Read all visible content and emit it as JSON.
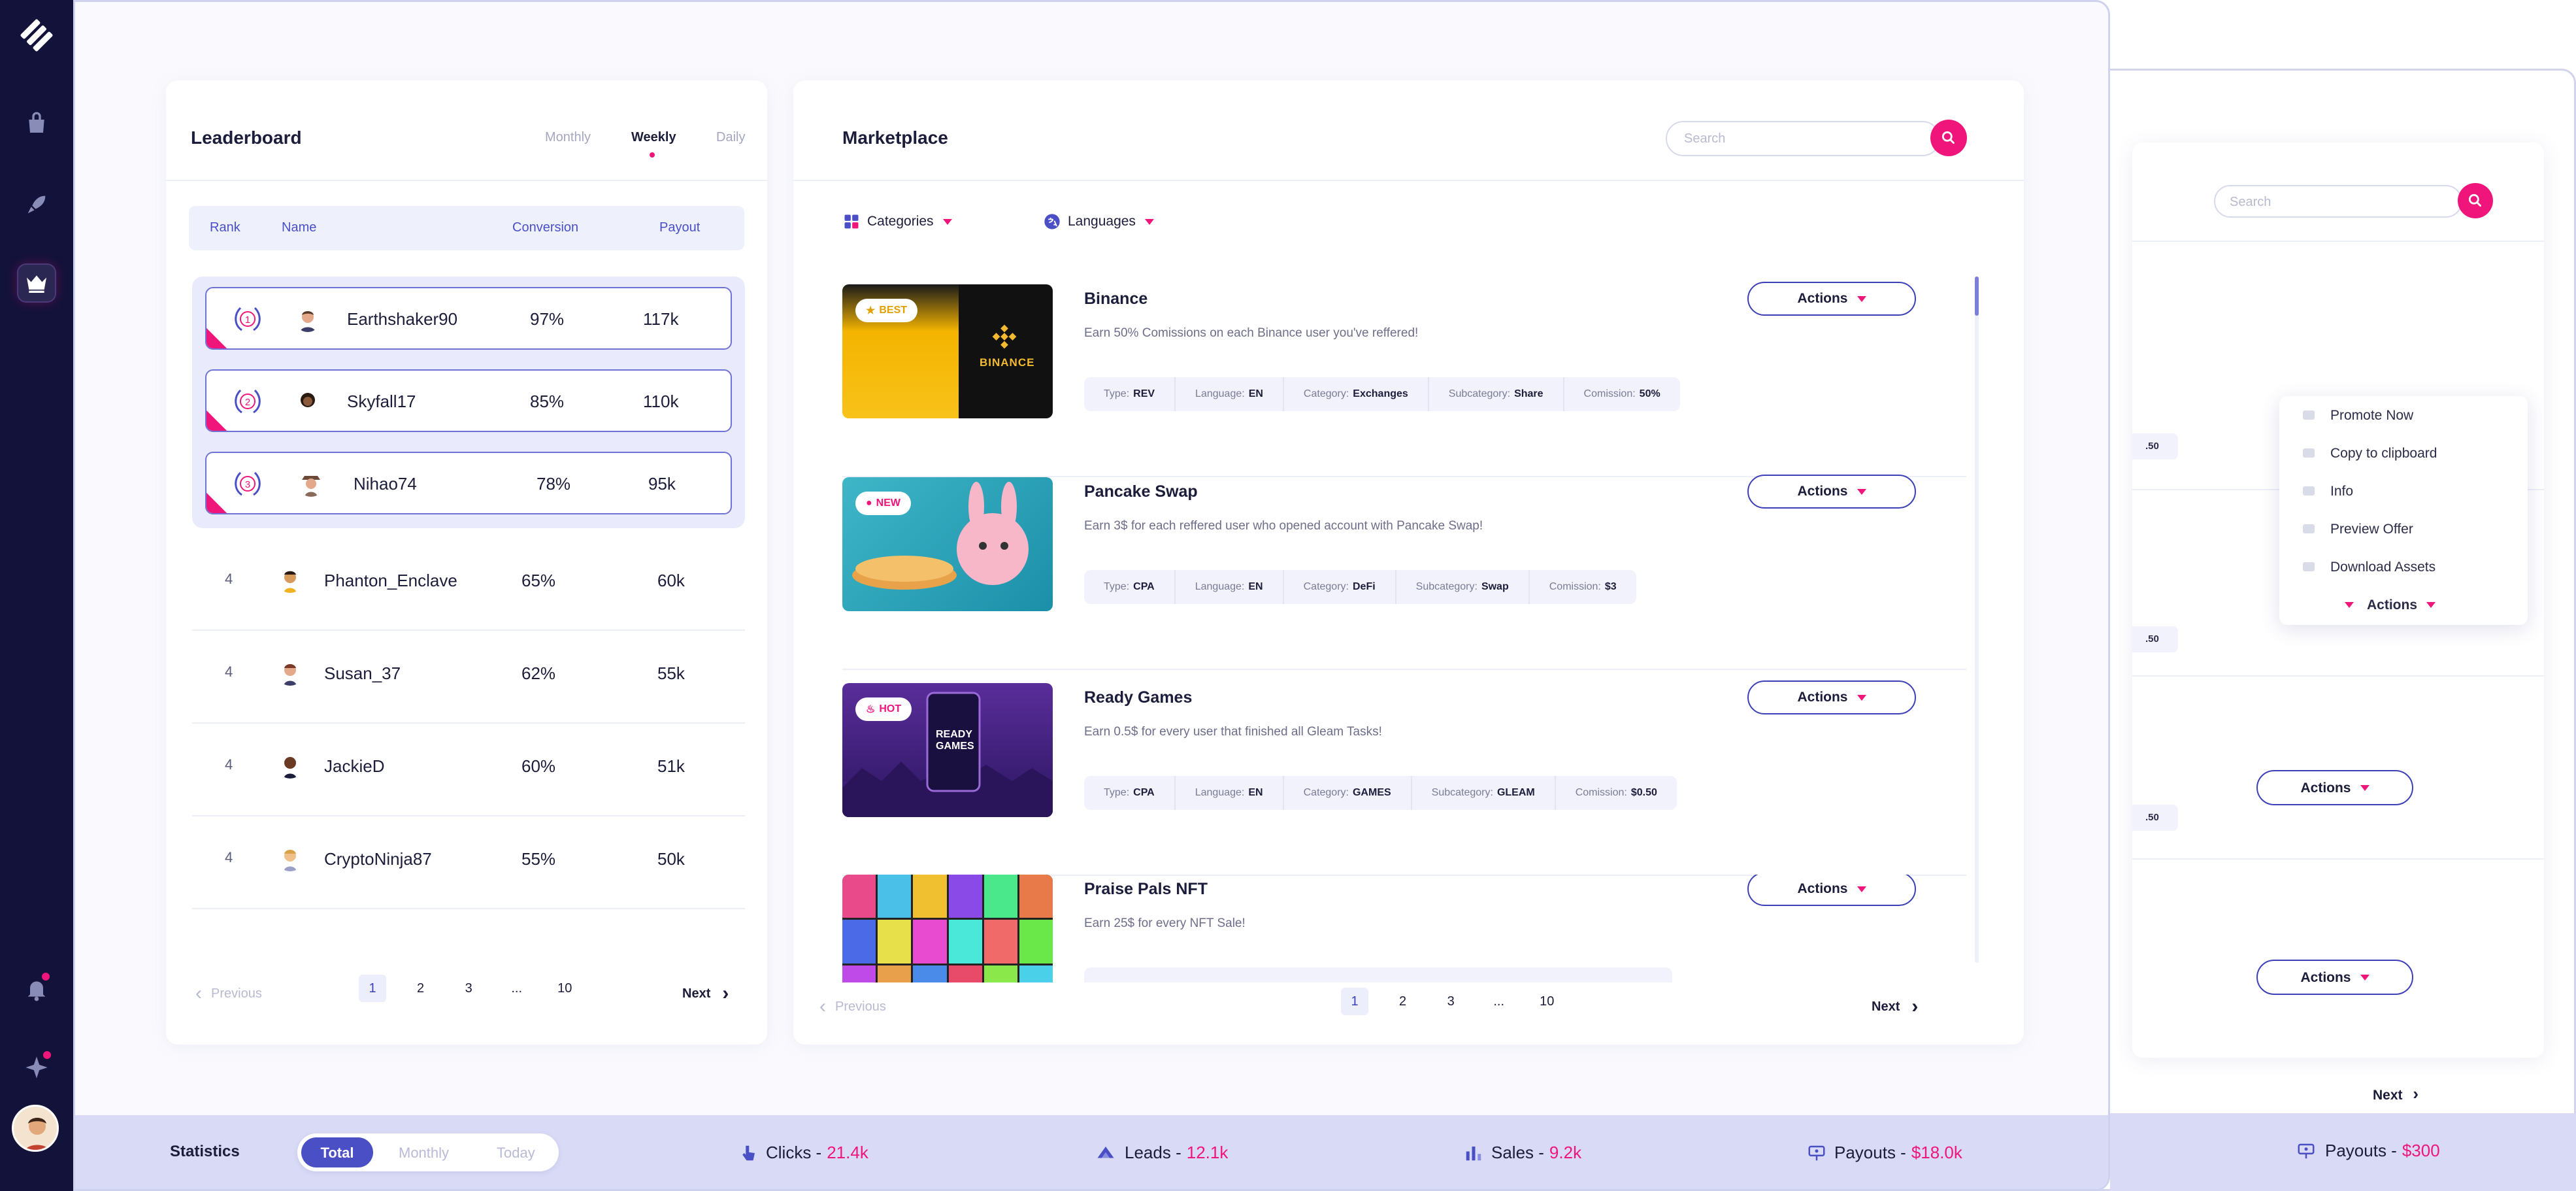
{
  "leaderboard": {
    "title": "Leaderboard",
    "tabs": [
      "Monthly",
      "Weekly",
      "Daily"
    ],
    "active_tab": "Weekly",
    "headers": {
      "rank": "Rank",
      "name": "Name",
      "conversion": "Conversion",
      "payout": "Payout"
    },
    "podium": [
      {
        "rank": "1",
        "name": "Earthshaker90",
        "conversion": "97%",
        "payout": "117k"
      },
      {
        "rank": "2",
        "name": "Skyfall17",
        "conversion": "85%",
        "payout": "110k"
      },
      {
        "rank": "3",
        "name": "Nihao74",
        "conversion": "78%",
        "payout": "95k"
      }
    ],
    "rows": [
      {
        "rank": "4",
        "name": "Phanton_Enclave",
        "conversion": "65%",
        "payout": "60k"
      },
      {
        "rank": "4",
        "name": "Susan_37",
        "conversion": "62%",
        "payout": "55k"
      },
      {
        "rank": "4",
        "name": "JackieD",
        "conversion": "60%",
        "payout": "51k"
      },
      {
        "rank": "4",
        "name": "CryptoNinja87",
        "conversion": "55%",
        "payout": "50k"
      }
    ],
    "pagination": {
      "previous": "Previous",
      "pages": [
        "1",
        "2",
        "3",
        "...",
        "10"
      ],
      "next": "Next",
      "current": "1"
    }
  },
  "marketplace": {
    "title": "Marketplace",
    "search_placeholder": "Search",
    "filters": {
      "categories": "Categories",
      "languages": "Languages"
    },
    "actions_label": "Actions",
    "offers": [
      {
        "title": "Binance",
        "badge": "BEST",
        "brand_text": "BINANCE",
        "description": "Earn 50% Comissions on each Binance user you've reffered!",
        "chips": [
          {
            "k": "Type:",
            "v": "REV"
          },
          {
            "k": "Language:",
            "v": "EN"
          },
          {
            "k": "Category:",
            "v": "Exchanges"
          },
          {
            "k": "Subcategory:",
            "v": "Share"
          },
          {
            "k": "Comission:",
            "v": "50%"
          }
        ]
      },
      {
        "title": "Pancake Swap",
        "badge": "NEW",
        "description": "Earn 3$ for each reffered user who opened account with Pancake Swap!",
        "chips": [
          {
            "k": "Type:",
            "v": "CPA"
          },
          {
            "k": "Language:",
            "v": "EN"
          },
          {
            "k": "Category:",
            "v": "DeFi"
          },
          {
            "k": "Subcategory:",
            "v": "Swap"
          },
          {
            "k": "Comission:",
            "v": "$3"
          }
        ]
      },
      {
        "title": "Ready Games",
        "badge": "HOT",
        "brand_text": "READY GAMES",
        "description": "Earn 0.5$ for every user that finished all Gleam Tasks!",
        "chips": [
          {
            "k": "Type:",
            "v": "CPA"
          },
          {
            "k": "Language:",
            "v": "EN"
          },
          {
            "k": "Category:",
            "v": "GAMES"
          },
          {
            "k": "Subcategory:",
            "v": "GLEAM"
          },
          {
            "k": "Comission:",
            "v": "$0.50"
          }
        ]
      },
      {
        "title": "Praise Pals NFT",
        "description": "Earn 25$ for every NFT Sale!"
      }
    ],
    "pagination": {
      "previous": "Previous",
      "pages": [
        "1",
        "2",
        "3",
        "...",
        "10"
      ],
      "next": "Next",
      "current": "1"
    }
  },
  "statistics": {
    "label": "Statistics",
    "toggle": [
      "Total",
      "Monthly",
      "Today"
    ],
    "active_toggle": "Total",
    "items": [
      {
        "label": "Clicks -",
        "value": "21.4k"
      },
      {
        "label": "Leads -",
        "value": "12.1k"
      },
      {
        "label": "Sales -",
        "value": "9.2k"
      },
      {
        "label": "Payouts -",
        "value": "$18.0k"
      }
    ]
  },
  "background_window": {
    "search_placeholder": "Search",
    "menu": [
      "Promote Now",
      "Copy to clipboard",
      "Info",
      "Preview Offer",
      "Download Assets"
    ],
    "actions_label": "Actions",
    "tag_text": ".50",
    "next": "Next",
    "payouts": {
      "label": "Payouts -",
      "value": "$300"
    }
  },
  "colors": {
    "accent": "#f0157a",
    "primary": "#4a4fc6",
    "sidebar": "#13123a",
    "stats_bar": "#d8daf6"
  },
  "icons": [
    "logo-icon",
    "shop-icon",
    "rocket-icon",
    "crown-icon",
    "bell-icon",
    "sparkle-icon",
    "search-icon",
    "grid-icon",
    "globe-icon",
    "click-icon",
    "leads-icon",
    "sales-icon",
    "payouts-icon"
  ]
}
